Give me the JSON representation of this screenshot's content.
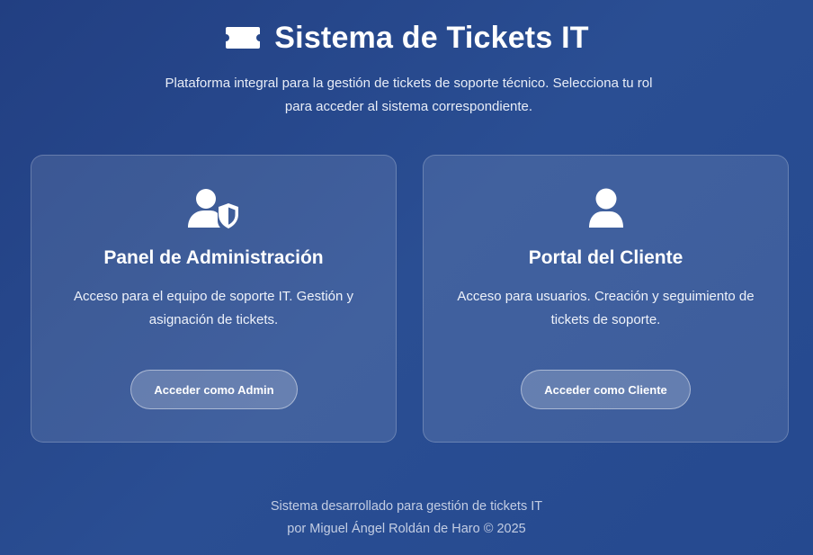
{
  "header": {
    "icon": "ticket-icon",
    "title": "Sistema de Tickets IT",
    "subtitle": "Plataforma integral para la gestión de tickets de soporte técnico. Selecciona tu rol para acceder al sistema correspondiente."
  },
  "cards": {
    "admin": {
      "icon": "user-shield-icon",
      "title": "Panel de Administración",
      "description": "Acceso para el equipo de soporte IT. Gestión y asignación de tickets.",
      "button_label": "Acceder como Admin"
    },
    "client": {
      "icon": "user-icon",
      "title": "Portal del Cliente",
      "description": "Acceso para usuarios. Creación y seguimiento de tickets de soporte.",
      "button_label": "Acceder como Cliente"
    }
  },
  "footer": {
    "line1": "Sistema desarrollado para gestión de tickets IT",
    "line2": "por Miguel Ángel Roldán de Haro © 2025"
  },
  "colors": {
    "background": "#2a4e93",
    "text": "#ffffff"
  }
}
